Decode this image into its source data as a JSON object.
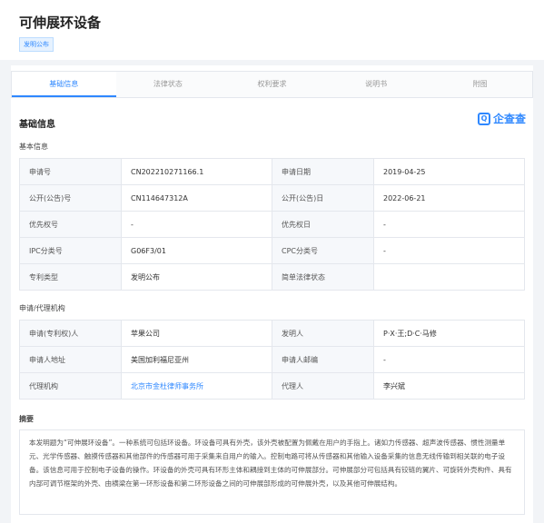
{
  "header": {
    "title": "可伸展环设备",
    "badge": "发明公布"
  },
  "tabs": [
    "基础信息",
    "法律状态",
    "权利要求",
    "说明书",
    "附图"
  ],
  "section_title": "基础信息",
  "logo_text": "企查查",
  "basic_info_title": "基本信息",
  "basic_info": [
    {
      "k1": "申请号",
      "v1": "CN202210271166.1",
      "k2": "申请日期",
      "v2": "2019-04-25"
    },
    {
      "k1": "公开(公告)号",
      "v1": "CN114647312A",
      "k2": "公开(公告)日",
      "v2": "2022-06-21"
    },
    {
      "k1": "优先权号",
      "v1": "-",
      "k2": "优先权日",
      "v2": "-"
    },
    {
      "k1": "IPC分类号",
      "v1": "G06F3/01",
      "k2": "CPC分类号",
      "v2": "-"
    },
    {
      "k1": "专利类型",
      "v1": "发明公布",
      "k2": "简单法律状态",
      "v2": ""
    }
  ],
  "applicant_title": "申请/代理机构",
  "applicant_info": [
    {
      "k1": "申请(专利权)人",
      "v1": "苹果公司",
      "k2": "发明人",
      "v2": "P·X·王;D·C·马修"
    },
    {
      "k1": "申请人地址",
      "v1": "美国加利福尼亚州",
      "k2": "申请人邮编",
      "v2": "-"
    },
    {
      "k1": "代理机构",
      "v1": "北京市金杜律师事务所",
      "k2": "代理人",
      "v2": "李兴斌"
    }
  ],
  "abstract_title": "摘要",
  "abstract": "本发明题为“可伸展环设备”。一种系统可包括环设备。环设备可具有外壳，该外壳被配置为佩戴在用户的手指上。诸如力传感器、超声波传感器、惯性测量单元、光学传感器、触摸传感器和其他部件的传感器可用于采集来自用户的输入。控制电路可将从传感器和其他输入设备采集的信息无线传输到相关联的电子设备。该信息可用于控制电子设备的操作。环设备的外壳可具有环形主体和耦接到主体的可伸展部分。可伸展部分可包括具有铰链的翼片、可旋转外壳构件、具有内部可调节框架的外壳、由横梁在第一环形设备和第二环形设备之间的可伸展部形成的可伸展外壳，以及其他可伸展结构。"
}
